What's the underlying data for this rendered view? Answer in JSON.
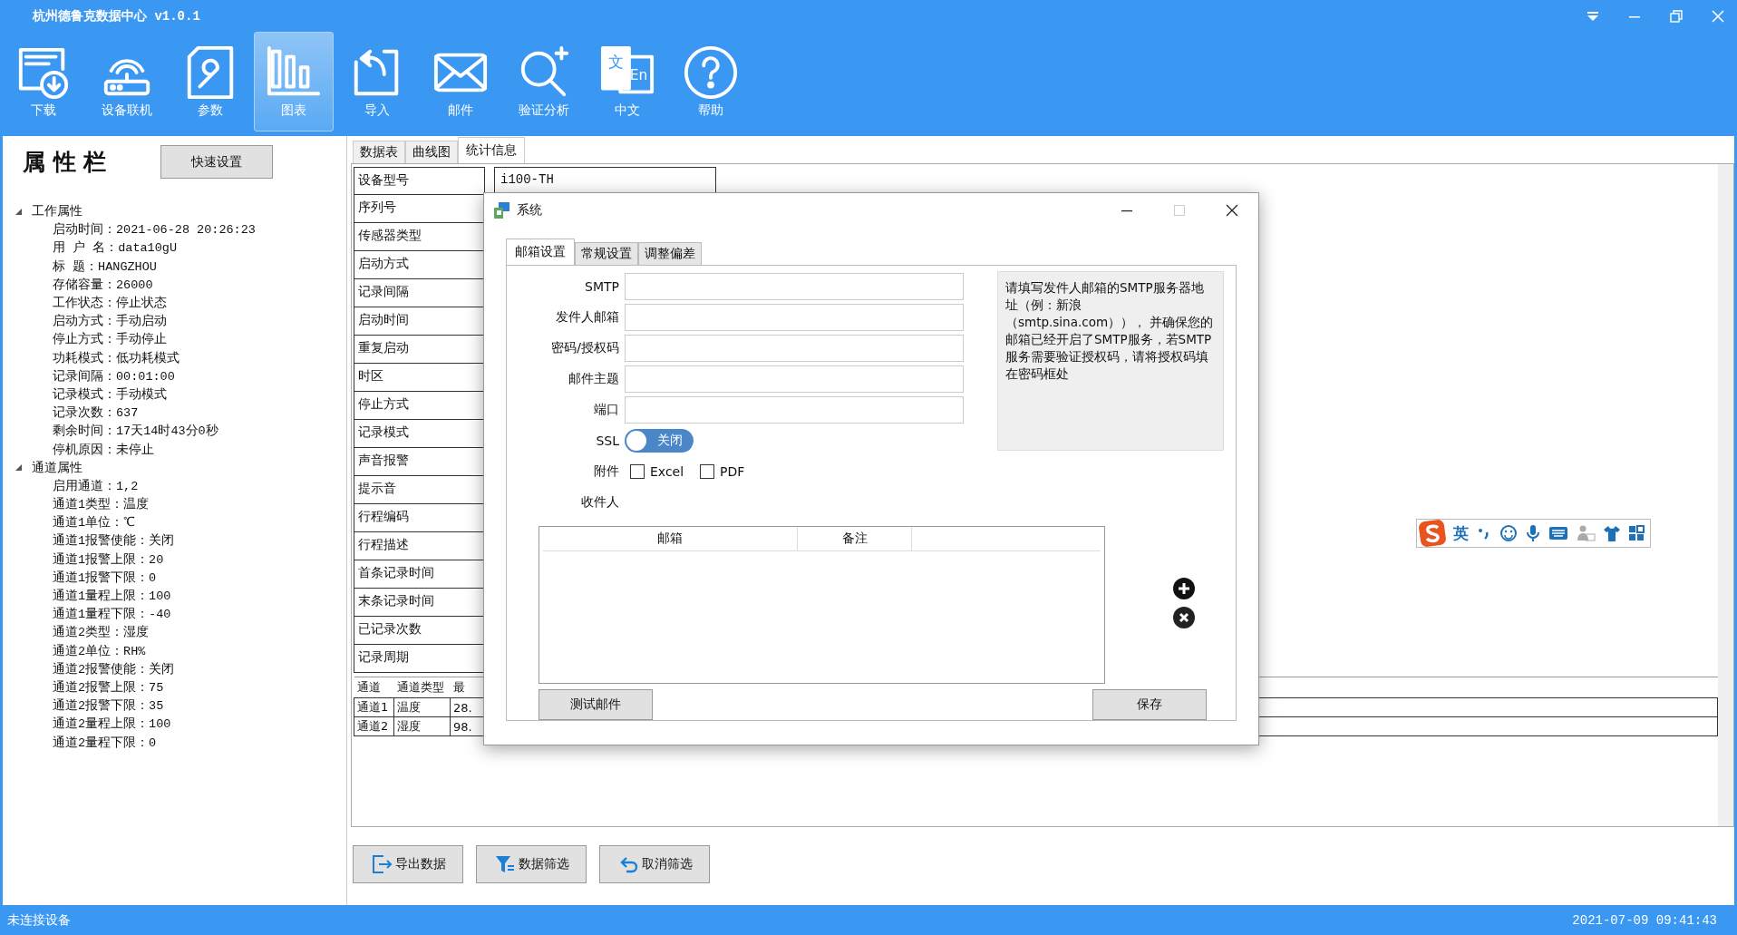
{
  "window": {
    "title": "杭州德鲁克数据中心 v1.0.1"
  },
  "toolbar": [
    {
      "label": "下载",
      "selected": false
    },
    {
      "label": "设备联机",
      "selected": false
    },
    {
      "label": "参数",
      "selected": false
    },
    {
      "label": "图表",
      "selected": true
    },
    {
      "label": "导入",
      "selected": false
    },
    {
      "label": "邮件",
      "selected": false
    },
    {
      "label": "验证分析",
      "selected": false
    },
    {
      "label": "中文",
      "selected": false,
      "icon_text": [
        "文",
        "En"
      ]
    },
    {
      "label": "帮助",
      "selected": false
    }
  ],
  "sidebar": {
    "title": "属 性 栏",
    "quick_button": "快速设置",
    "tree": [
      {
        "label": "工作属性",
        "expanded": true,
        "children": [
          {
            "label": "启动时间：2021-06-28 20:26:23"
          },
          {
            "label": "用 户 名：data10gU"
          },
          {
            "label": "标 题：HANGZHOU"
          },
          {
            "label": "存储容量：26000"
          },
          {
            "label": "工作状态：停止状态"
          },
          {
            "label": "启动方式：手动启动"
          },
          {
            "label": "停止方式：手动停止"
          },
          {
            "label": "功耗模式：低功耗模式"
          },
          {
            "label": "记录间隔：00:01:00"
          },
          {
            "label": "记录模式：手动模式"
          },
          {
            "label": "记录次数：637"
          },
          {
            "label": "剩余时间：17天14时43分0秒"
          },
          {
            "label": "停机原因：未停止"
          }
        ]
      },
      {
        "label": "通道属性",
        "expanded": true,
        "children": [
          {
            "label": "启用通道：1,2"
          },
          {
            "label": "通道1类型：温度"
          },
          {
            "label": "通道1单位：℃"
          },
          {
            "label": "通道1报警使能：关闭"
          },
          {
            "label": "通道1报警上限：20"
          },
          {
            "label": "通道1报警下限：0"
          },
          {
            "label": "通道1量程上限：100"
          },
          {
            "label": "通道1量程下限：-40"
          },
          {
            "label": "通道2类型：湿度"
          },
          {
            "label": "通道2单位：RH%"
          },
          {
            "label": "通道2报警使能：关闭"
          },
          {
            "label": "通道2报警上限：75"
          },
          {
            "label": "通道2报警下限：35"
          },
          {
            "label": "通道2量程上限：100"
          },
          {
            "label": "通道2量程下限：0"
          }
        ]
      }
    ]
  },
  "tabs": [
    {
      "label": "数据表",
      "selected": false
    },
    {
      "label": "曲线图",
      "selected": false
    },
    {
      "label": "统计信息",
      "selected": true
    }
  ],
  "info_table": {
    "rows": [
      {
        "label": "设备型号",
        "value": "i100-TH"
      },
      {
        "label": "序列号"
      },
      {
        "label": "传感器类型"
      },
      {
        "label": "启动方式"
      },
      {
        "label": "记录间隔"
      },
      {
        "label": "启动时间"
      },
      {
        "label": "重复启动"
      },
      {
        "label": "时区"
      },
      {
        "label": "停止方式"
      },
      {
        "label": "记录模式"
      },
      {
        "label": "声音报警"
      },
      {
        "label": "提示音"
      },
      {
        "label": "行程编码"
      },
      {
        "label": "行程描述"
      },
      {
        "label": "首条记录时间"
      },
      {
        "label": "末条记录时间"
      },
      {
        "label": "已记录次数"
      },
      {
        "label": "记录周期"
      }
    ]
  },
  "channel_table": {
    "columns": [
      "通道",
      "通道类型",
      "最"
    ],
    "rows": [
      [
        "通道1",
        "温度",
        "28."
      ],
      [
        "通道2",
        "湿度",
        "98."
      ]
    ]
  },
  "actions": [
    {
      "label": "导出数据"
    },
    {
      "label": "数据筛选"
    },
    {
      "label": "取消筛选"
    }
  ],
  "dialog": {
    "title": "系统",
    "tabs": [
      {
        "label": "邮箱设置",
        "selected": true
      },
      {
        "label": "常规设置",
        "selected": false
      },
      {
        "label": "调整偏差",
        "selected": false
      }
    ],
    "fields": [
      {
        "label": "SMTP"
      },
      {
        "label": "发件人邮箱"
      },
      {
        "label": "密码/授权码"
      },
      {
        "label": "邮件主题"
      },
      {
        "label": "端口"
      }
    ],
    "ssl": {
      "label": "SSL",
      "on": false,
      "state_text": "关闭"
    },
    "attachments": {
      "label": "附件",
      "options": [
        {
          "label": "Excel",
          "checked": false
        },
        {
          "label": "PDF",
          "checked": false
        }
      ]
    },
    "recipients": {
      "label": "收件人",
      "columns": [
        "邮箱",
        "备注"
      ]
    },
    "help": "请填写发件人邮箱的SMTP服务器地址（例：新浪（smtp.sina.com））， 并确保您的邮箱已经开启了SMTP服务，若SMTP服务需要验证授权码，请将授权码填在密码框处",
    "buttons": [
      {
        "label": "测试邮件"
      },
      {
        "label": "保存"
      }
    ]
  },
  "ime": {
    "mode": "英"
  },
  "status_bar": {
    "left": "未连接设备",
    "right": "2021-07-09 09:41:43"
  }
}
